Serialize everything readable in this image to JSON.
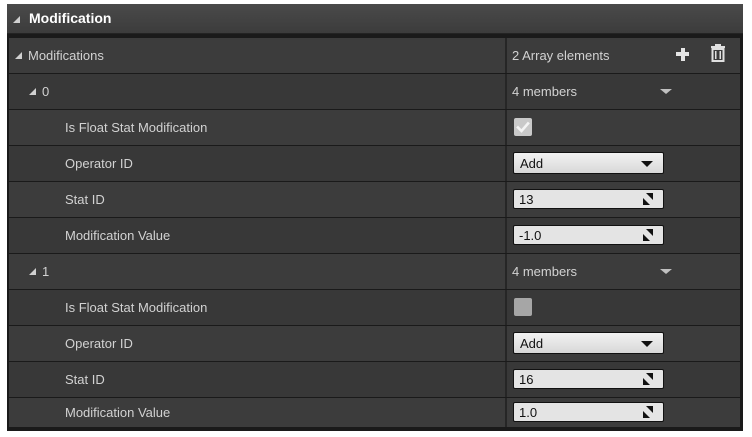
{
  "section": {
    "title": "Modification"
  },
  "array": {
    "label": "Modifications",
    "count_label": "2 Array elements",
    "add_icon": "plus-icon",
    "clear_icon": "trash-icon"
  },
  "elements": [
    {
      "index_label": "0",
      "members_label": "4 members",
      "fields": {
        "is_float_label": "Is Float Stat Modification",
        "is_float_checked": true,
        "operator_label": "Operator ID",
        "operator_value": "Add",
        "stat_label": "Stat ID",
        "stat_value": "13",
        "mod_label": "Modification Value",
        "mod_value": "-1.0"
      }
    },
    {
      "index_label": "1",
      "members_label": "4 members",
      "fields": {
        "is_float_label": "Is Float Stat Modification",
        "is_float_checked": false,
        "operator_label": "Operator ID",
        "operator_value": "Add",
        "stat_label": "Stat ID",
        "stat_value": "16",
        "mod_label": "Modification Value",
        "mod_value": "1.0"
      }
    }
  ],
  "colors": {
    "panel_bg": "#1a1a1a",
    "row_bg": "#383838",
    "header_bg": "#444444",
    "text": "#d2d2d2",
    "field_bg": "#e4e4e4"
  }
}
